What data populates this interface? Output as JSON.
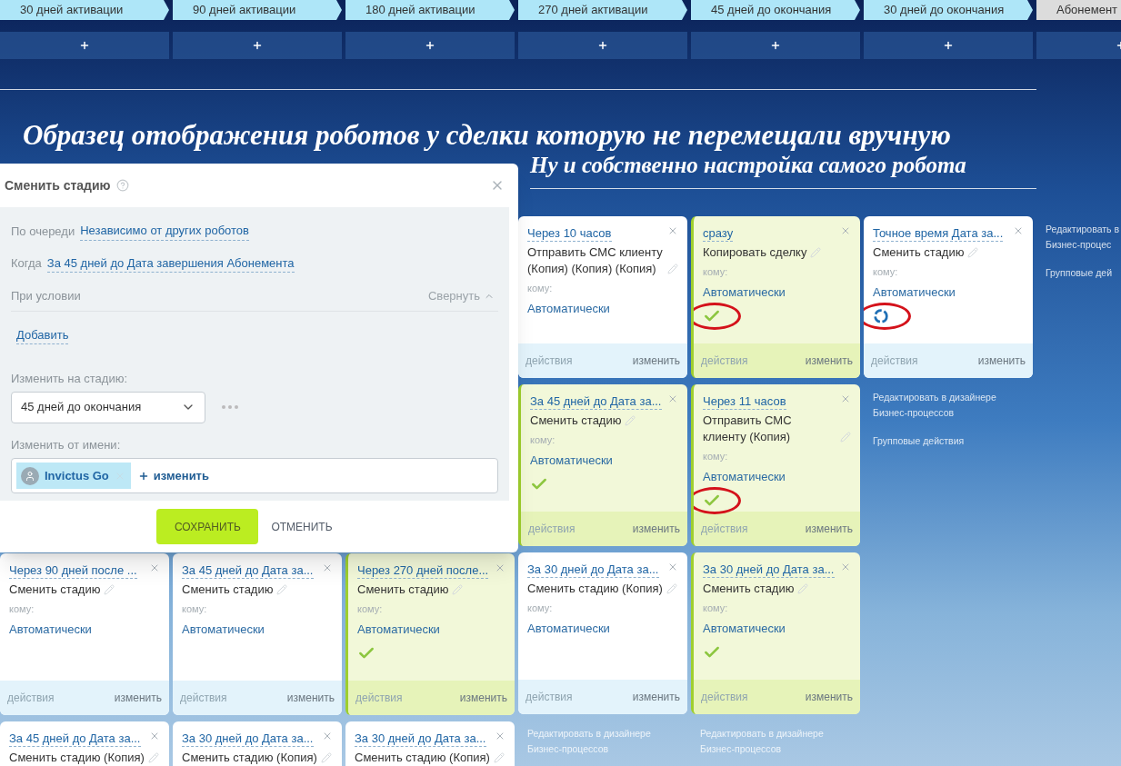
{
  "stages": [
    {
      "label": "30 дней активации",
      "color": "#aee6f8"
    },
    {
      "label": "90 дней активации",
      "color": "#aee6f8"
    },
    {
      "label": "180 дней активации",
      "color": "#aee6f8"
    },
    {
      "label": "270 дней активации",
      "color": "#aee6f8"
    },
    {
      "label": "45 дней до окончания",
      "color": "#aee6f8"
    },
    {
      "label": "30 дней до окончания",
      "color": "#aee6f8"
    },
    {
      "label": "Абонемент",
      "color": "#dcdcdc"
    }
  ],
  "heading": "Образец отображения роботов у сделки которую не перемещали вручную",
  "subheading": "Ну и собственно настройка самого робота",
  "columns": [
    {
      "cards": [
        {
          "title": "Через 90 дней после ...",
          "action": "Сменить стадию",
          "recipient_label": "кому:",
          "recipient": "Автоматически",
          "completed": false,
          "footer_left": "действия",
          "footer_right": "изменить"
        },
        {
          "title": "За 45 дней до Дата за...",
          "action": "Сменить стадию (Копия)",
          "completed": false
        }
      ]
    },
    {
      "cards": [
        {
          "title": "За 45 дней до Дата за...",
          "action": "Сменить стадию",
          "recipient_label": "кому:",
          "recipient": "Автоматически",
          "completed": false,
          "footer_left": "действия",
          "footer_right": "изменить"
        },
        {
          "title": "За 30 дней до Дата за...",
          "action": "Сменить стадию (Копия)",
          "completed": false
        }
      ]
    },
    {
      "cards": [
        {
          "title": "Через 270 дней после...",
          "action": "Сменить стадию",
          "recipient_label": "кому:",
          "recipient": "Автоматически",
          "completed": true,
          "footer_left": "действия",
          "footer_right": "изменить"
        },
        {
          "title": "За 30 дней до Дата за...",
          "action": "Сменить стадию (Копия)",
          "completed": false
        }
      ]
    },
    {
      "cards": [
        {
          "title": "Через 10 часов",
          "action": "Отправить СМС клиенту (Копия) (Копия) (Копия)",
          "recipient_label": "кому:",
          "recipient": "Автоматически",
          "completed": false,
          "footer_left": "действия",
          "footer_right": "изменить"
        },
        {
          "title": "За 45 дней до Дата за...",
          "action": "Сменить стадию",
          "recipient_label": "кому:",
          "recipient": "Автоматически",
          "completed": true,
          "footer_left": "действия",
          "footer_right": "изменить"
        },
        {
          "title": "За 30 дней до Дата за...",
          "action": "Сменить стадию (Копия)",
          "recipient_label": "кому:",
          "recipient": "Автоматически",
          "completed": false,
          "footer_left": "действия",
          "footer_right": "изменить"
        }
      ],
      "links": [
        "Редактировать в дизайнере Бизнес-процессов"
      ]
    },
    {
      "cards": [
        {
          "title": "сразу",
          "action": "Копировать сделку",
          "recipient_label": "кому:",
          "recipient": "Автоматически",
          "completed": true,
          "marked": true,
          "footer_left": "действия",
          "footer_right": "изменить"
        },
        {
          "title": "Через 11 часов",
          "action": "Отправить СМС клиенту (Копия)",
          "recipient_label": "кому:",
          "recipient": "Автоматически",
          "completed": true,
          "marked": true,
          "footer_left": "действия",
          "footer_right": "изменить"
        },
        {
          "title": "За 30 дней до Дата за...",
          "action": "Сменить стадию",
          "recipient_label": "кому:",
          "recipient": "Автоматически",
          "completed": true,
          "footer_left": "действия",
          "footer_right": "изменить"
        }
      ],
      "links": [
        "Редактировать в дизайнере Бизнес-процессов"
      ]
    },
    {
      "cards": [
        {
          "title": "Точное время Дата за...",
          "action": "Сменить стадию",
          "recipient_label": "кому:",
          "recipient": "Автоматически",
          "completed": false,
          "running": true,
          "marked": true,
          "footer_left": "действия",
          "footer_right": "изменить"
        }
      ],
      "links": [
        "Редактировать в дизайнере Бизнес-процессов",
        "Групповые действия"
      ]
    },
    {
      "links": [
        "Редактировать в Бизнес-процес",
        "Групповые дей"
      ]
    }
  ],
  "dialog": {
    "title": "Сменить стадию",
    "order_label": "По очереди",
    "order_value": "Независимо от других роботов",
    "when_label": "Когда",
    "when_value": "За 45 дней до Дата завершения Абонемента",
    "condition_label": "При условии",
    "collapse": "Свернуть",
    "add": "Добавить",
    "stage_label": "Изменить на стадию:",
    "stage_value": "45 дней до окончания",
    "user_label": "Изменить от имени:",
    "user_name": "Invictus Go",
    "change": "изменить",
    "save": "СОХРАНИТЬ",
    "cancel": "ОТМЕНИТЬ"
  }
}
